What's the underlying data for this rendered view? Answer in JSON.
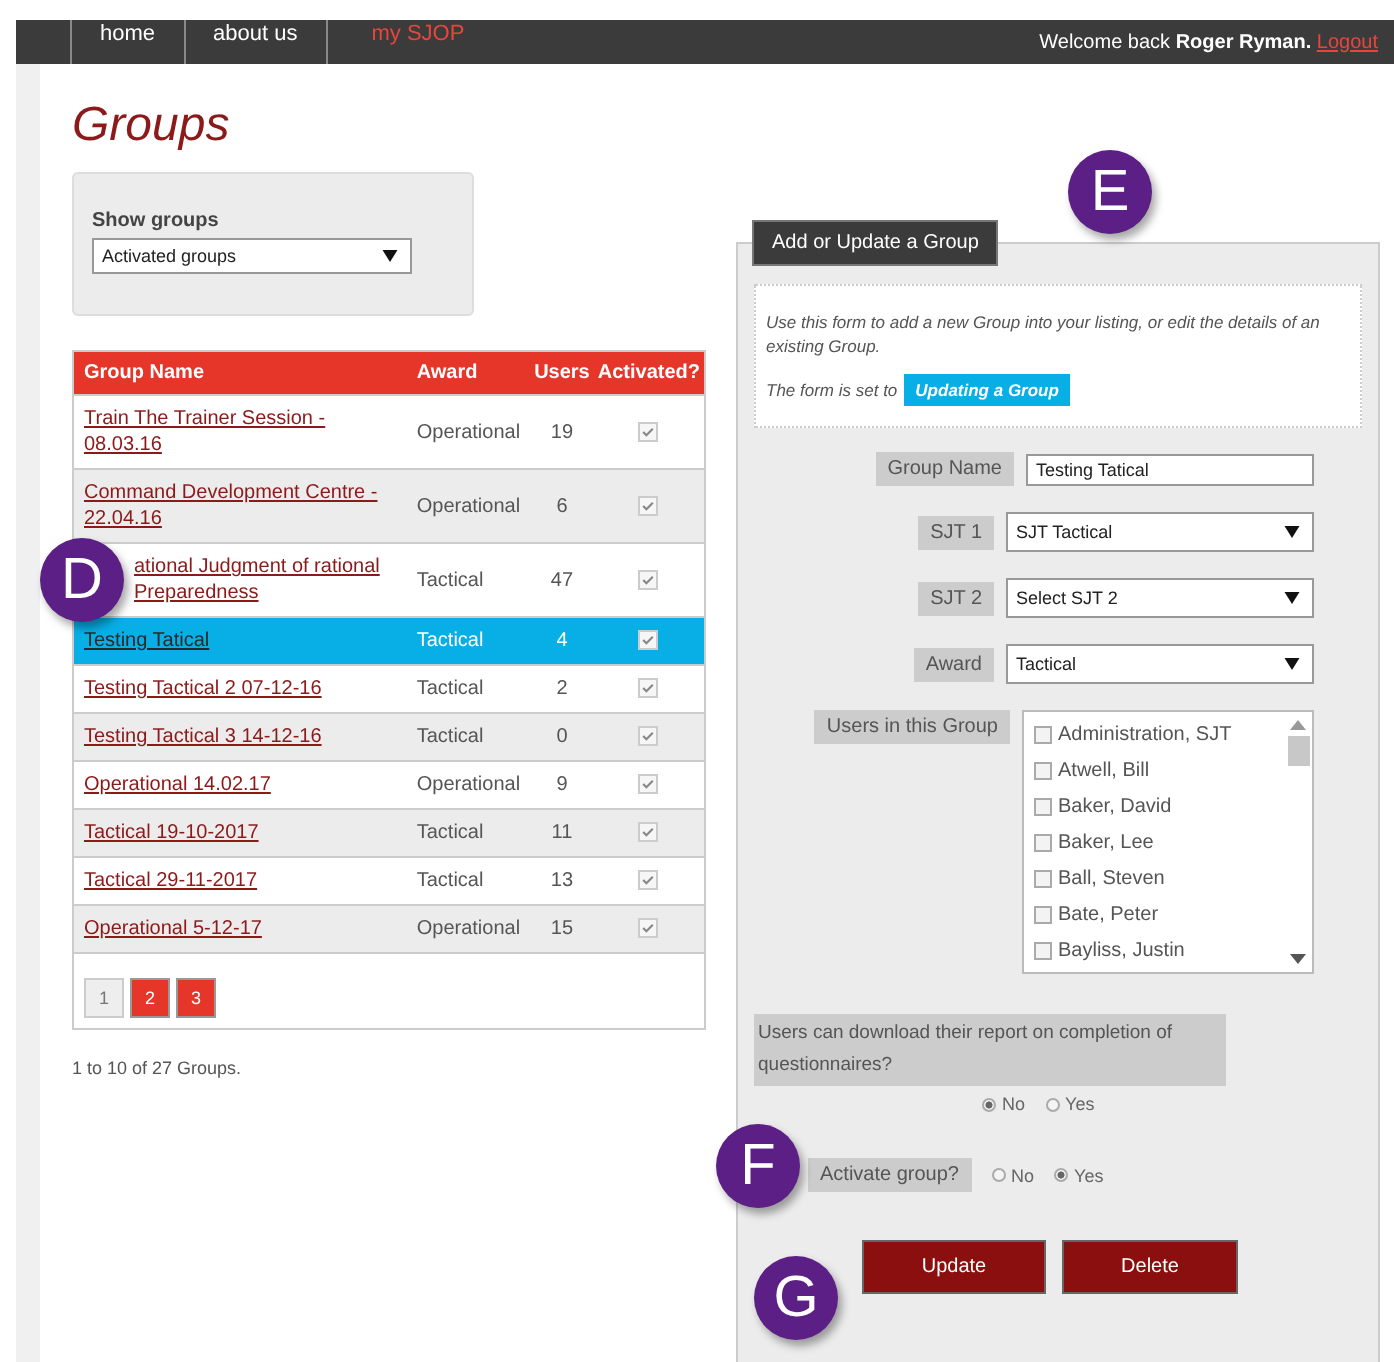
{
  "nav": {
    "items": [
      {
        "label": "home",
        "selected": false
      },
      {
        "label": "about us",
        "selected": false
      },
      {
        "label": "my SJOP",
        "selected": true
      }
    ],
    "welcome": "Welcome back **Roger Ryman.**",
    "logout": "Logout"
  },
  "title": "Groups",
  "filter": {
    "label": "Show groups",
    "value": "Activated groups"
  },
  "table": {
    "columns": [
      "Group Name",
      "Award",
      "Users",
      "Activated?"
    ],
    "rows": [
      {
        "name": "Train The Trainer Session - 08.03.16",
        "award": "Operational",
        "users": "19",
        "activated": true,
        "selected": false
      },
      {
        "name": "Command Development Centre - 22.04.16",
        "award": "Operational",
        "users": "6",
        "activated": true,
        "selected": false
      },
      {
        "name": "ational Judgment of rational Preparedness",
        "award": "Tactical",
        "users": "47",
        "activated": true,
        "selected": false
      },
      {
        "name": "Testing Tatical",
        "award": "Tactical",
        "users": "4",
        "activated": true,
        "selected": true
      },
      {
        "name": "Testing Tactical 2 07-12-16",
        "award": "Tactical",
        "users": "2",
        "activated": true,
        "selected": false
      },
      {
        "name": "Testing Tactical 3 14-12-16",
        "award": "Tactical",
        "users": "0",
        "activated": true,
        "selected": false
      },
      {
        "name": "Operational 14.02.17",
        "award": "Operational",
        "users": "9",
        "activated": true,
        "selected": false
      },
      {
        "name": "Tactical 19-10-2017",
        "award": "Tactical",
        "users": "11",
        "activated": true,
        "selected": false
      },
      {
        "name": "Tactical 29-11-2017",
        "award": "Tactical",
        "users": "13",
        "activated": true,
        "selected": false
      },
      {
        "name": "Operational 5-12-17",
        "award": "Operational",
        "users": "15",
        "activated": true,
        "selected": false
      }
    ],
    "pages": [
      {
        "label": "1",
        "selected": true
      },
      {
        "label": "2",
        "selected": false
      },
      {
        "label": "3",
        "selected": false
      }
    ],
    "summary": "1 to 10 of 27 Groups."
  },
  "form": {
    "tab": "Add or Update a Group",
    "intro": "Use this form to add a new Group into your listing, or edit the details of an existing Group.",
    "mode_label": "The form is set to",
    "mode": "Updating a Group",
    "fields": [
      {
        "kind": "text",
        "label": "Group Name",
        "value": "Testing Tatical"
      },
      {
        "kind": "select",
        "label": "SJT 1",
        "value": "SJT Tactical"
      },
      {
        "kind": "select",
        "label": "SJT 2",
        "value": "Select SJT 2"
      },
      {
        "kind": "select",
        "label": "Award",
        "value": "Tactical"
      }
    ],
    "users_label": "Users in this Group",
    "users": [
      {
        "name": "Administration, SJT",
        "checked": false
      },
      {
        "name": "Atwell, Bill",
        "checked": false
      },
      {
        "name": "Baker, David",
        "checked": false
      },
      {
        "name": "Baker, Lee",
        "checked": false
      },
      {
        "name": "Ball, Steven",
        "checked": false
      },
      {
        "name": "Bate, Peter",
        "checked": false
      },
      {
        "name": "Bayliss, Justin",
        "checked": false
      }
    ],
    "download_question": "Users can download their report on completion of questionnaires?",
    "download_options": [
      {
        "label": "No",
        "selected": true
      },
      {
        "label": "Yes",
        "selected": false
      }
    ],
    "activate_label": "Activate group?",
    "activate_options": [
      {
        "label": "No",
        "selected": false
      },
      {
        "label": "Yes",
        "selected": true
      }
    ],
    "buttons": [
      "Update",
      "Delete"
    ]
  },
  "callouts": [
    "D",
    "E",
    "F",
    "G"
  ]
}
